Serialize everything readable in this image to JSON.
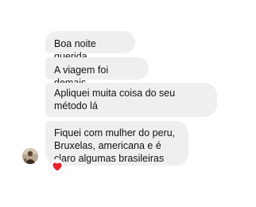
{
  "messages": [
    {
      "text": "Boa noite querida"
    },
    {
      "text": "A viagem foi demais"
    },
    {
      "text": "Apliquei muita coisa do seu método lá"
    },
    {
      "text": "Fiquei com mulher do peru, Bruxelas, americana e é claro algumas brasileiras"
    }
  ],
  "reaction": {
    "icon": "red-heart-icon",
    "color": "#e8202a"
  },
  "colors": {
    "bubble": "#efefef",
    "text": "#111111",
    "background": "#ffffff"
  }
}
